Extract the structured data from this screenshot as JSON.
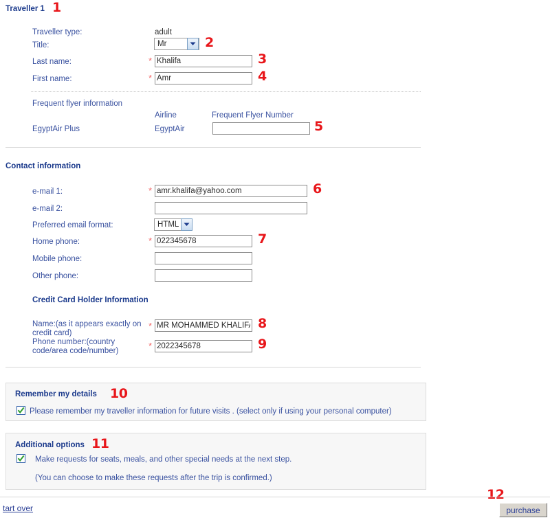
{
  "traveller": {
    "heading": "Traveller 1",
    "type_label": "Traveller type:",
    "type_value": "adult",
    "title_label": "Title:",
    "title_value": "Mr",
    "last_name_label": "Last name:",
    "last_name_value": "Khalifa",
    "first_name_label": "First name:",
    "first_name_value": "Amr",
    "required_mark": "*"
  },
  "frequent_flyer": {
    "heading": "Frequent flyer information",
    "col_airline": "Airline",
    "col_number": "Frequent Flyer Number",
    "program": "EgyptAir Plus",
    "airline": "EgyptAir",
    "number_value": ""
  },
  "contact": {
    "heading": "Contact information",
    "email1_label": "e-mail 1:",
    "email1_value": "amr.khalifa@yahoo.com",
    "email2_label": "e-mail 2:",
    "email2_value": "",
    "format_label": "Preferred email format:",
    "format_value": "HTML",
    "home_phone_label": "Home phone:",
    "home_phone_value": "022345678",
    "mobile_phone_label": "Mobile phone:",
    "mobile_phone_value": "",
    "other_phone_label": "Other phone:",
    "other_phone_value": ""
  },
  "credit_card": {
    "heading": "Credit Card Holder Information",
    "name_label_line1": "Name:(as it appears exactly on",
    "name_label_line2": "credit card)",
    "name_value": "MR MOHAMMED KHALIFA",
    "phone_label_line1": "Phone number:(country",
    "phone_label_line2": "code/area code/number)",
    "phone_value": "2022345678"
  },
  "remember_panel": {
    "heading": "Remember my details",
    "checkbox_label": "Please remember my traveller information for future visits . (select only if using your personal computer)",
    "checked": true
  },
  "additional_panel": {
    "heading": "Additional options",
    "checkbox_label": "Make requests for seats, meals, and other special needs at the next step.",
    "note": "(You can choose to make these requests after the trip is confirmed.)",
    "checked": true
  },
  "footer": {
    "start_over": "tart over",
    "purchase": "purchase"
  },
  "annotations": {
    "n1": "1",
    "n2": "2",
    "n3": "3",
    "n4": "4",
    "n5": "5",
    "n6": "6",
    "n7": "7",
    "n8": "8",
    "n9": "9",
    "n10": "10",
    "n11": "11",
    "n12": "12"
  },
  "colors": {
    "label_blue": "#3a52a0",
    "heading_blue": "#1b3a8c",
    "annotation_red": "#e8161a",
    "required_red": "#f26b6b",
    "check_green": "#2f9e2f",
    "panel_bg": "#f7f7f7"
  }
}
